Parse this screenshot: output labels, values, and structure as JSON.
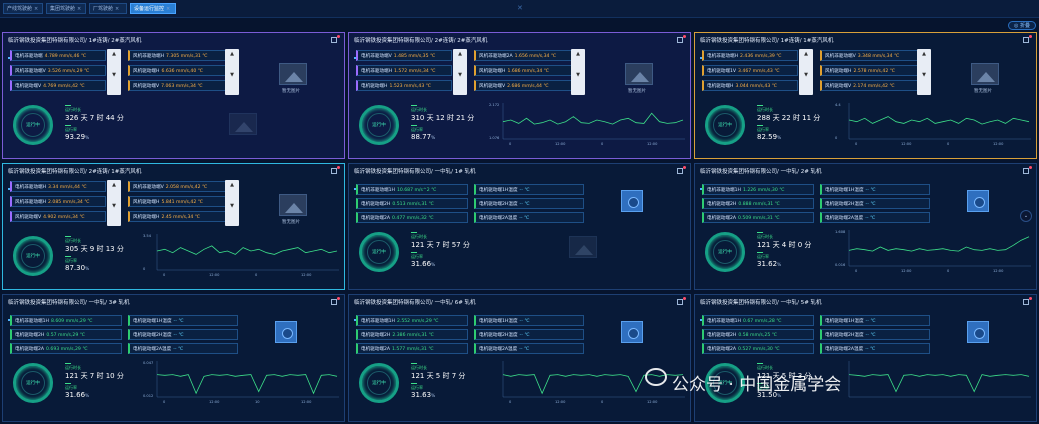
{
  "tabs": [
    {
      "label": "产线驾驶舱",
      "active": false
    },
    {
      "label": "集团驾驶舱",
      "active": false
    },
    {
      "label": "厂驾驶舱",
      "active": false
    },
    {
      "label": "设备运行监控",
      "active": true
    }
  ],
  "collapse_label": "◎ 折叠",
  "panels": [
    {
      "title": "临沂钢铁投资集团特钢有限公司/ 1#连铸/ 2#蒸汽风机",
      "rows": [
        {
          "label": "电机非驱动端",
          "value": "4.789 mm/s,46 ℃"
        },
        {
          "label": "风机非驱动端V",
          "value": "3.526 mm/s,29 ℃"
        },
        {
          "label": "电机驱动端V",
          "value": "4.769 mm/s,42 ℃"
        },
        {
          "label": "风机非驱动端H",
          "value": "7.305 mm/s,31 ℃"
        },
        {
          "label": "风机驱动端H",
          "value": "6.636 mm/s,40 ℃"
        },
        {
          "label": "风机驱动端V",
          "value": "7.063 mm/s,34 ℃"
        }
      ],
      "image_label": "暂无图片",
      "status": "运行中",
      "runtime_label": "运行时长",
      "runtime": "326 天 7 时 44 分",
      "rate_label": "运行率",
      "rate": "93.29",
      "pct": "%"
    },
    {
      "title": "临沂钢铁投资集团特钢有限公司/ 2#连铸/ 2#蒸汽风机",
      "rows": [
        {
          "label": "电机非驱动端V",
          "value": "1.485 mm/s,35 ℃"
        },
        {
          "label": "电机非驱动端H",
          "value": "1.572 mm/s,34 ℃"
        },
        {
          "label": "电机驱动端H",
          "value": "1.523 mm/s,43 ℃"
        },
        {
          "label": "风机非驱动端2A",
          "value": "1.656 mm/s,34 ℃"
        },
        {
          "label": "风机驱动端H",
          "value": "1.686 mm/s,34 ℃"
        },
        {
          "label": "风机驱动端V",
          "value": "2.686 mm/s,44 ℃"
        }
      ],
      "image_label": "暂无图片",
      "status": "运行中",
      "runtime_label": "运行时长",
      "runtime": "310 天 12 时 21 分",
      "rate_label": "运行率",
      "rate": "88.77",
      "pct": "%",
      "y_top": "2.172",
      "y_bot": "1.076",
      "ticks": [
        "0",
        "12:00",
        "0",
        "12:00"
      ]
    },
    {
      "title": "临沂钢铁投资集团特钢有限公司/ 1#连铸/ 1#蒸汽风机",
      "rows": [
        {
          "label": "电机非驱动端H",
          "value": "2.436 mm/s,39 ℃"
        },
        {
          "label": "电机驱动端1V",
          "value": "3.467 mm/s,43 ℃"
        },
        {
          "label": "电机驱动端H",
          "value": "3.044 mm/s,43 ℃"
        },
        {
          "label": "风机非驱动端V",
          "value": "3.348 mm/s,34 ℃"
        },
        {
          "label": "风机驱动端H",
          "value": "2.578 mm/s,42 ℃"
        },
        {
          "label": "风机驱动端V",
          "value": "2.174 mm/s,42 ℃"
        }
      ],
      "image_label": "暂无图片",
      "status": "运行中",
      "runtime_label": "运行时长",
      "runtime": "288 天 22 时 11 分",
      "rate_label": "运行率",
      "rate": "82.59",
      "pct": "%",
      "y_top": "4.4",
      "y_bot": "0",
      "ticks": [
        "0",
        "12:00",
        "0",
        "12:00"
      ]
    },
    {
      "title": "临沂钢铁投资集团特钢有限公司/ 2#连铸/ 1#蒸汽风机",
      "rows": [
        {
          "label": "电机非驱动端H",
          "value": "3.34 mm/s,44 ℃"
        },
        {
          "label": "风机非驱动端H",
          "value": "2.085 mm/s,34 ℃"
        },
        {
          "label": "风机驱动端V",
          "value": "4.902 mm/s,34 ℃"
        },
        {
          "label": "风机非驱动端V",
          "value": "2.058 mm/s,42 ℃"
        },
        {
          "label": "风机驱动端H",
          "value": "5.841 mm/s,42 ℃"
        },
        {
          "label": "风机驱动端H",
          "value": "2.45 mm/s,34 ℃"
        }
      ],
      "image_label": "暂无图片",
      "status": "运行中",
      "runtime_label": "运行时长",
      "runtime": "305 天 9 时 13 分",
      "rate_label": "运行率",
      "rate": "87.30",
      "pct": "%",
      "y_top": "3.54",
      "y_bot": "0",
      "ticks": [
        "0",
        "12:00",
        "0",
        "12:00"
      ]
    },
    {
      "title": "临沂钢铁投资集团特钢有限公司/ 一中轧/ 1# 轧机",
      "rows": [
        {
          "label": "电机非驱动端1H",
          "value": "10.687 m/s^2 ℃"
        },
        {
          "label": "电机驱动端2H",
          "value": "0.513 mm/s,31 ℃"
        },
        {
          "label": "电机驱动端2A",
          "value": "0.477 mm/s,32 ℃"
        },
        {
          "label": "电机驱动端1H温度",
          "value": "-- ℃"
        },
        {
          "label": "电机驱动端2H温度",
          "value": "-- ℃"
        },
        {
          "label": "电机驱动端2A温度",
          "value": "-- ℃"
        }
      ],
      "status": "运行中",
      "runtime_label": "运行时长",
      "runtime": "121 天 7 时 57 分",
      "rate_label": "运行率",
      "rate": "31.66",
      "pct": "%"
    },
    {
      "title": "临沂钢铁投资集团特钢有限公司/ 一中轧/ 2# 轧机",
      "rows": [
        {
          "label": "电机非驱动端1H",
          "value": "1.226 mm/s,30 ℃"
        },
        {
          "label": "电机驱动端2H",
          "value": "0.888 mm/s,31 ℃"
        },
        {
          "label": "电机驱动端2A",
          "value": "0.509 mm/s,31 ℃"
        },
        {
          "label": "电机驱动端1H温度",
          "value": "-- ℃"
        },
        {
          "label": "电机驱动端2H温度",
          "value": "-- ℃"
        },
        {
          "label": "电机驱动端2A温度",
          "value": "-- ℃"
        }
      ],
      "status": "运行中",
      "runtime_label": "运行时长",
      "runtime": "121 天 4 时 0 分",
      "rate_label": "运行率",
      "rate": "31.62",
      "pct": "%",
      "y_top": "1.608",
      "y_bot": "0.016",
      "ticks": [
        "0",
        "12:00",
        "0",
        "12:00"
      ]
    },
    {
      "title": "临沂钢铁投资集团特钢有限公司/ 一中轧/ 3# 轧机",
      "rows": [
        {
          "label": "电机非驱动端1H",
          "value": "8.609 mm/s,29 ℃"
        },
        {
          "label": "电机驱动端2H",
          "value": "0.57 mm/s,29 ℃"
        },
        {
          "label": "电机驱动端2A",
          "value": "0.693 mm/s,29 ℃"
        },
        {
          "label": "电机驱动端1H温度",
          "value": "-- ℃"
        },
        {
          "label": "电机驱动端2H温度",
          "value": "-- ℃"
        },
        {
          "label": "电机驱动端2A温度",
          "value": "-- ℃"
        }
      ],
      "status": "运行中",
      "runtime_label": "运行时长",
      "runtime": "121 天 7 时 10 分",
      "rate_label": "运行率",
      "rate": "31.66",
      "pct": "%",
      "y_top": "0.047",
      "y_bot": "0.012",
      "ticks": [
        "0",
        "12:00",
        "10",
        "12:00"
      ]
    },
    {
      "title": "临沂钢铁投资集团特钢有限公司/ 一中轧/ 6# 轧机",
      "rows": [
        {
          "label": "电机非驱动端1H",
          "value": "2.552 mm/s,29 ℃"
        },
        {
          "label": "电机驱动端2H",
          "value": "2.386 mm/s,31 ℃"
        },
        {
          "label": "电机驱动端2A",
          "value": "1.577 mm/s,31 ℃"
        },
        {
          "label": "电机驱动端1H温度",
          "value": "-- ℃"
        },
        {
          "label": "电机驱动端2H温度",
          "value": "-- ℃"
        },
        {
          "label": "电机驱动端2A温度",
          "value": "-- ℃"
        }
      ],
      "status": "运行中",
      "runtime_label": "运行时长",
      "runtime": "121 天 5 时 7 分",
      "rate_label": "运行率",
      "rate": "31.63",
      "pct": "%",
      "ticks": [
        "0",
        "12:00",
        "0",
        "12:00"
      ]
    },
    {
      "title": "临沂钢铁投资集团特钢有限公司/ 一中轧/ 5# 轧机",
      "rows": [
        {
          "label": "电机非驱动端1H",
          "value": "0.67 mm/s,28 ℃"
        },
        {
          "label": "电机驱动端2H",
          "value": "0.58 mm/s,25 ℃"
        },
        {
          "label": "电机驱动端2A",
          "value": "0.527 mm/s,30 ℃"
        },
        {
          "label": "电机驱动端1H温度",
          "value": "-- ℃"
        },
        {
          "label": "电机驱动端2H温度",
          "value": "-- ℃"
        },
        {
          "label": "电机驱动端2A温度",
          "value": "-- ℃"
        }
      ],
      "status": "运行中",
      "runtime_label": "运行时长",
      "runtime": "121 天 5 时 3 分",
      "rate_label": "运行率",
      "rate": "31.50",
      "pct": "%"
    }
  ],
  "watermark": "公众号 · 中国金属学会",
  "colors": {
    "accent": "#2a7fd4",
    "ok": "#3de08a",
    "warn": "#ffb347",
    "bg": "#06142e"
  }
}
